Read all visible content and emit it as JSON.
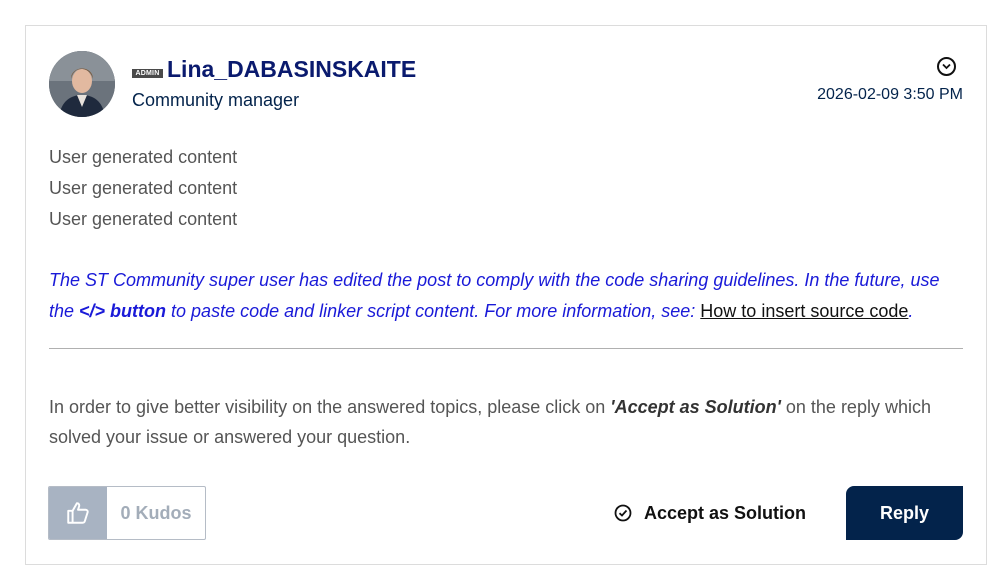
{
  "author": {
    "badge": "ADMIN",
    "username": "Lina_DABASINSKAITE",
    "rank": "Community manager"
  },
  "post": {
    "timestamp": "2026-02-09 3:50 PM",
    "content_lines": [
      "User generated content",
      "User generated content",
      "User generated content"
    ],
    "notice": {
      "part1": "The ST Community super user has edited the post to comply with the code sharing guidelines. In the future, use the ",
      "bold": "</> button",
      "part2": " to paste code and linker script content. For more information, see: ",
      "link": "How to insert source code",
      "end": "."
    },
    "footer": {
      "part1": "In order to give better visibility on the answered topics, please click on ",
      "bold": "'Accept as Solution'",
      "part2": " on the reply which solved your issue or answered your question."
    }
  },
  "actions": {
    "kudos_label": "0 Kudos",
    "accept_label": "Accept as Solution",
    "reply_label": "Reply"
  },
  "icons": {
    "options": "chevron-down-circle-icon",
    "kudos": "thumbs-up-icon",
    "accept": "check-circle-icon"
  },
  "colors": {
    "username": "#0a1a6e",
    "notice": "#1a1ad8",
    "reply_bg": "#03234b",
    "kudos_bg": "#a8b3c2"
  }
}
